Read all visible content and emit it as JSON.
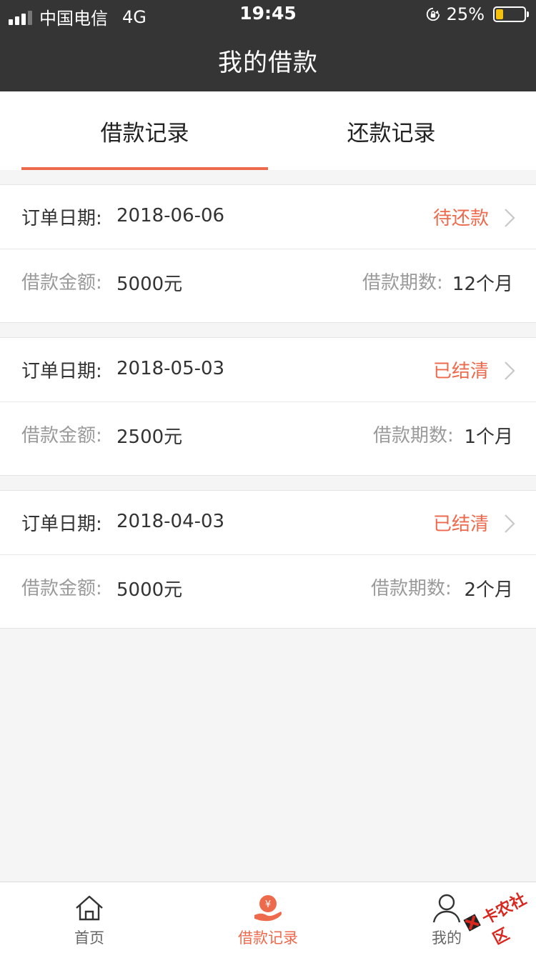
{
  "status_bar": {
    "carrier": "中国电信",
    "network": "4G",
    "time": "19:45",
    "battery": "25%",
    "battery_level": 0.25
  },
  "header": {
    "title": "我的借款"
  },
  "tabs": [
    {
      "label": "借款记录",
      "active": true
    },
    {
      "label": "还款记录",
      "active": false
    }
  ],
  "labels": {
    "order_date": "订单日期:",
    "amount": "借款金额:",
    "periods": "借款期数:"
  },
  "loans": [
    {
      "date": "2018-06-06",
      "status": "待还款",
      "amount": "5000元",
      "periods": "12个月"
    },
    {
      "date": "2018-05-03",
      "status": "已结清",
      "amount": "2500元",
      "periods": "1个月"
    },
    {
      "date": "2018-04-03",
      "status": "已结清",
      "amount": "5000元",
      "periods": "2个月"
    }
  ],
  "bottom_nav": [
    {
      "label": "首页",
      "icon": "home-icon",
      "active": false
    },
    {
      "label": "借款记录",
      "icon": "loan-hand-icon",
      "active": true
    },
    {
      "label": "我的",
      "icon": "person-icon",
      "active": false
    }
  ],
  "watermark": {
    "text": "卡农社区"
  },
  "colors": {
    "accent": "#ee6a4c",
    "header_bg": "#353535",
    "page_bg": "#f5f5f5"
  }
}
